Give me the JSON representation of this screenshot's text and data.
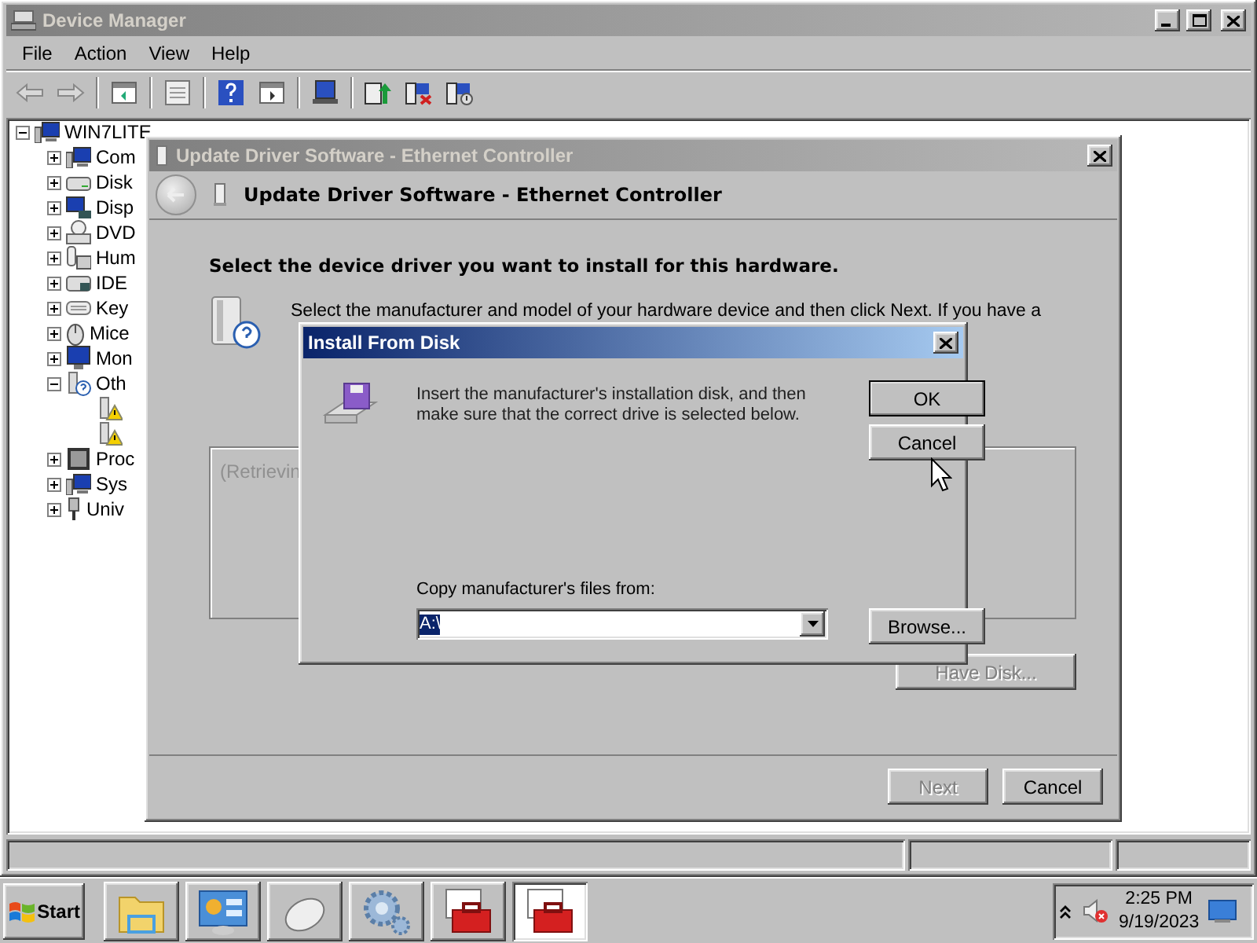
{
  "device_manager": {
    "title": "Device Manager",
    "menu": [
      "File",
      "Action",
      "View",
      "Help"
    ],
    "tree": {
      "label": "WIN7LITE",
      "kind": "computer",
      "expanded": true,
      "children": [
        {
          "label": "Com",
          "kind": "computer",
          "expanded": false
        },
        {
          "label": "Disk",
          "kind": "disk",
          "expanded": false
        },
        {
          "label": "Disp",
          "kind": "display",
          "expanded": false
        },
        {
          "label": "DVD",
          "kind": "dvd",
          "expanded": false
        },
        {
          "label": "Hum",
          "kind": "hid",
          "expanded": false
        },
        {
          "label": "IDE",
          "kind": "ide",
          "expanded": false
        },
        {
          "label": "Key",
          "kind": "keyboard",
          "expanded": false
        },
        {
          "label": "Mice",
          "kind": "mouse",
          "expanded": false
        },
        {
          "label": "Mon",
          "kind": "monitor",
          "expanded": false
        },
        {
          "label": "Oth",
          "kind": "other",
          "expanded": true,
          "children": [
            {
              "kind": "warning"
            },
            {
              "kind": "warning"
            }
          ]
        },
        {
          "label": "Proc",
          "kind": "processor",
          "expanded": false
        },
        {
          "label": "Sys",
          "kind": "computer",
          "expanded": false
        },
        {
          "label": "Univ",
          "kind": "usb",
          "expanded": false
        }
      ]
    }
  },
  "update_driver": {
    "title": "Update Driver Software - Ethernet Controller",
    "heading": "Update Driver Software - Ethernet Controller",
    "instruction": "Select the device driver you want to install for this hardware.",
    "description": "Select the manufacturer and model of your hardware device and then click Next. If you have a",
    "list_text": "(Retrievin",
    "have_disk": {
      "label": "Have Disk...",
      "disabled": true
    },
    "buttons": [
      {
        "label": "Next",
        "disabled": true
      },
      {
        "label": "Cancel",
        "disabled": false
      }
    ]
  },
  "install_from_disk": {
    "title": "Install From Disk",
    "message": "Insert the manufacturer's installation disk, and then make sure that the correct drive is selected below.",
    "buttons": [
      {
        "label": "OK",
        "default": true
      },
      {
        "label": "Cancel",
        "default": false
      }
    ],
    "copy_label": "Copy manufacturer's files from:",
    "path": "A:\\",
    "browse": "Browse..."
  },
  "taskbar": {
    "start": "Start",
    "tasks": [
      {
        "kind": "folder",
        "selected": false
      },
      {
        "kind": "control-panel",
        "selected": false
      },
      {
        "kind": "mouse",
        "selected": false
      },
      {
        "kind": "gears",
        "selected": false
      },
      {
        "kind": "toolbox",
        "selected": false
      },
      {
        "kind": "toolbox",
        "selected": true
      }
    ],
    "time": "2:25 PM",
    "date": "9/19/2023"
  }
}
